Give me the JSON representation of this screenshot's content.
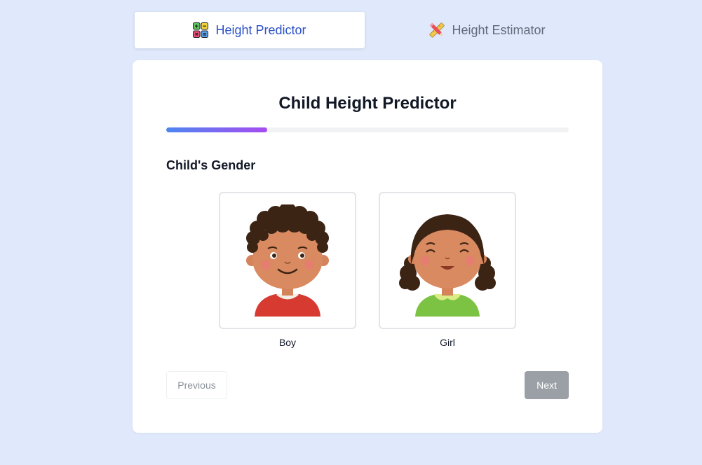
{
  "tabs": [
    {
      "label": "Height Predictor",
      "icon": "calculator-grid-icon",
      "active": true
    },
    {
      "label": "Height Estimator",
      "icon": "ruler-pencil-icon",
      "active": false
    }
  ],
  "card": {
    "title": "Child Height Predictor",
    "progress_percent": 25,
    "section_label": "Child's Gender",
    "options": [
      {
        "label": "Boy",
        "icon": "boy-face-icon"
      },
      {
        "label": "Girl",
        "icon": "girl-face-icon"
      }
    ],
    "previous_label": "Previous",
    "next_label": "Next"
  },
  "colors": {
    "background": "#dfe9fb",
    "active_tab_text": "#2a50c8",
    "progress_start": "#4d86f0",
    "progress_end": "#a74cf0",
    "next_button": "#9ba0a7"
  }
}
